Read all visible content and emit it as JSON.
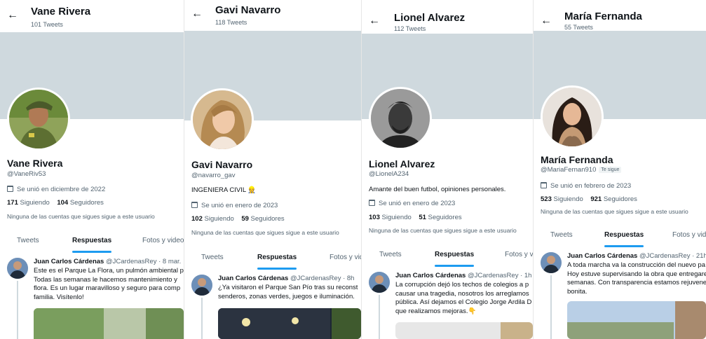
{
  "panels": [
    {
      "header_name": "Vane Rivera",
      "tweets_count": "101 Tweets",
      "display_name": "Vane Rivera",
      "handle": "@VaneRiv53",
      "follows_you": "",
      "bio": "",
      "joined": "Se unió en diciembre de 2022",
      "following_count": "171",
      "following_label": "Siguiendo",
      "followers_count": "104",
      "followers_label": "Seguidores",
      "no_followers_note": "Ninguna de las cuentas que sigues sigue a este usuario",
      "tabs": [
        "Tweets",
        "Respuestas",
        "Fotos y video"
      ],
      "tweet": {
        "author": "Juan Carlos Cárdenas",
        "author_handle": "@JCardenasRey",
        "time": "· 8 mar.",
        "text": "Este es el Parque La Flora, un pulmón ambiental p\nTodas las semanas le hacemos mantenimiento y\nflora. Es un lugar maravilloso y seguro para comp\nfamilia. Visítenlo!"
      }
    },
    {
      "header_name": "Gavi Navarro",
      "tweets_count": "118 Tweets",
      "display_name": "Gavi Navarro",
      "handle": "@navarro_gav",
      "follows_you": "",
      "bio": "INGENIERA CIVIL 👷",
      "joined": "Se unió en enero de 2023",
      "following_count": "102",
      "following_label": "Siguiendo",
      "followers_count": "59",
      "followers_label": "Seguidores",
      "no_followers_note": "Ninguna de las cuentas que sigues sigue a este usuario",
      "tabs": [
        "Tweets",
        "Respuestas",
        "Fotos y vid"
      ],
      "tweet": {
        "author": "Juan Carlos Cárdenas",
        "author_handle": "@JCardenasRey",
        "time": "· 8h",
        "text": "¿Ya visitaron el Parque San Pío tras su reconst\nsenderos, zonas verdes, juegos e iluminación."
      }
    },
    {
      "header_name": "Lionel Alvarez",
      "tweets_count": "112 Tweets",
      "display_name": "Lionel Alvarez",
      "handle": "@LionelA234",
      "follows_you": "",
      "bio": "Amante del buen futbol, opiniones personales.",
      "joined": "Se unió en enero de 2023",
      "following_count": "103",
      "following_label": "Siguiendo",
      "followers_count": "51",
      "followers_label": "Seguidores",
      "no_followers_note": "Ninguna de las cuentas que sigues sigue a este usuario",
      "tabs": [
        "Tweets",
        "Respuestas",
        "Fotos y v"
      ],
      "tweet": {
        "author": "Juan Carlos Cárdenas",
        "author_handle": "@JCardenasRey",
        "time": "· 1h",
        "text": "La corrupción dejó los techos de colegios a p\ncausar una tragedia, nosotros los arreglamos\npública. Así dejamos el Colegio Jorge Ardila D\nque realizamos mejoras.👇"
      }
    },
    {
      "header_name": "María Fernanda",
      "tweets_count": "55 Tweets",
      "display_name": "María Fernanda",
      "handle": "@MariaFernan910",
      "follows_you": "Te sigue",
      "bio": "",
      "joined": "Se unió en febrero de 2023",
      "following_count": "523",
      "following_label": "Siguiendo",
      "followers_count": "921",
      "followers_label": "Seguidores",
      "no_followers_note": "Ninguna de las cuentas que sigues sigue a este usuario",
      "tabs": [
        "Tweets",
        "Respuestas",
        "Fotos y vide"
      ],
      "tweet": {
        "author": "Juan Carlos Cárdenas",
        "author_handle": "@JCardenasRey",
        "time": "· 21h",
        "text": "A toda marcha va la construcción del nuevo pa\nHoy estuve supervisando la obra que entregare\nsemanas. Con transparencia estamos rejuvene\nbonita."
      }
    }
  ],
  "colors": {
    "banner": "#cfd9de",
    "accent": "#1d9bf0",
    "secondary_text": "#536471"
  }
}
